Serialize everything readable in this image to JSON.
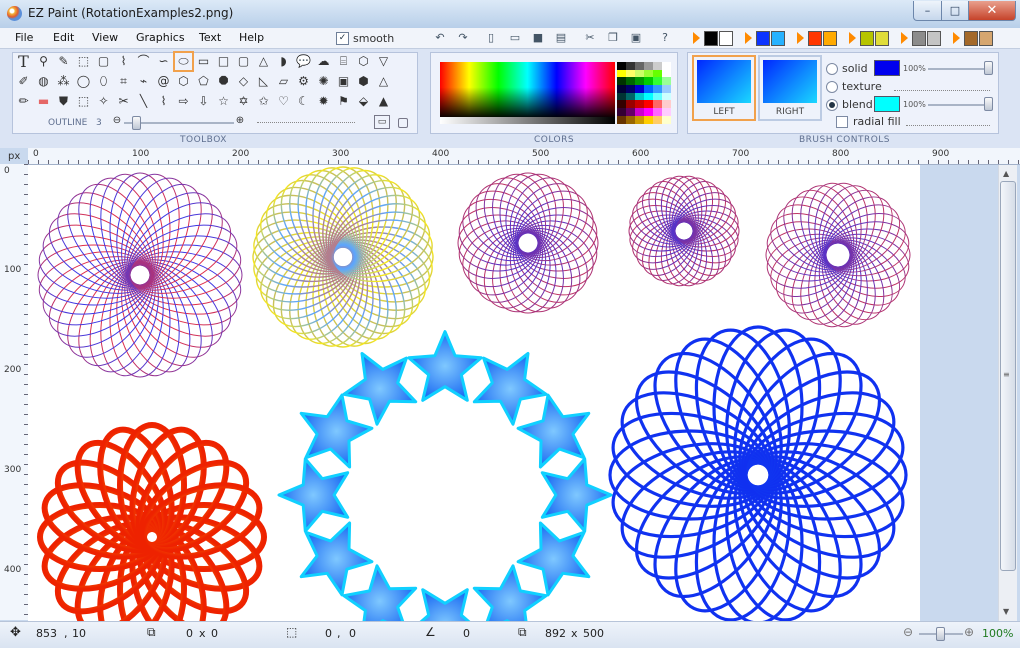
{
  "window": {
    "title": "EZ Paint (RotationExamples2.png)",
    "minimize": "–",
    "maximize": "□",
    "close": "✕"
  },
  "menu": [
    "File",
    "Edit",
    "View",
    "Graphics",
    "Text",
    "Help"
  ],
  "toolbar": {
    "smooth_label": "smooth",
    "smooth_checked": "✓"
  },
  "toolbox": {
    "label": "TOOLBOX",
    "outline_label": "OUTLINE",
    "outline_value": "3"
  },
  "colors": {
    "label": "COLORS"
  },
  "brush": {
    "label": "BRUSH CONTROLS",
    "left_label": "LEFT",
    "right_label": "RIGHT",
    "solid_label": "solid",
    "texture_label": "texture",
    "blend_label": "blend",
    "radial_label": "radial fill",
    "solid_pct": "100%",
    "blend_pct": "100%",
    "solid_color": "#0000ee",
    "blend_color": "#00ffff"
  },
  "ruler": {
    "unit": "px",
    "top": [
      "0",
      "100",
      "200",
      "300",
      "400",
      "500",
      "600",
      "700",
      "800",
      "900"
    ],
    "left": [
      "0",
      "100",
      "200",
      "300",
      "400"
    ]
  },
  "status": {
    "cursor_x": "853",
    "cursor_sep": ",",
    "cursor_y": "10",
    "sel_w": "0",
    "sel_x": "x",
    "sel_h": "0",
    "pos_x": "0",
    "pos_sep": ",",
    "pos_y": "0",
    "angle": "0",
    "img_w": "892",
    "img_x": "x",
    "img_h": "500",
    "zoom": "100%"
  }
}
